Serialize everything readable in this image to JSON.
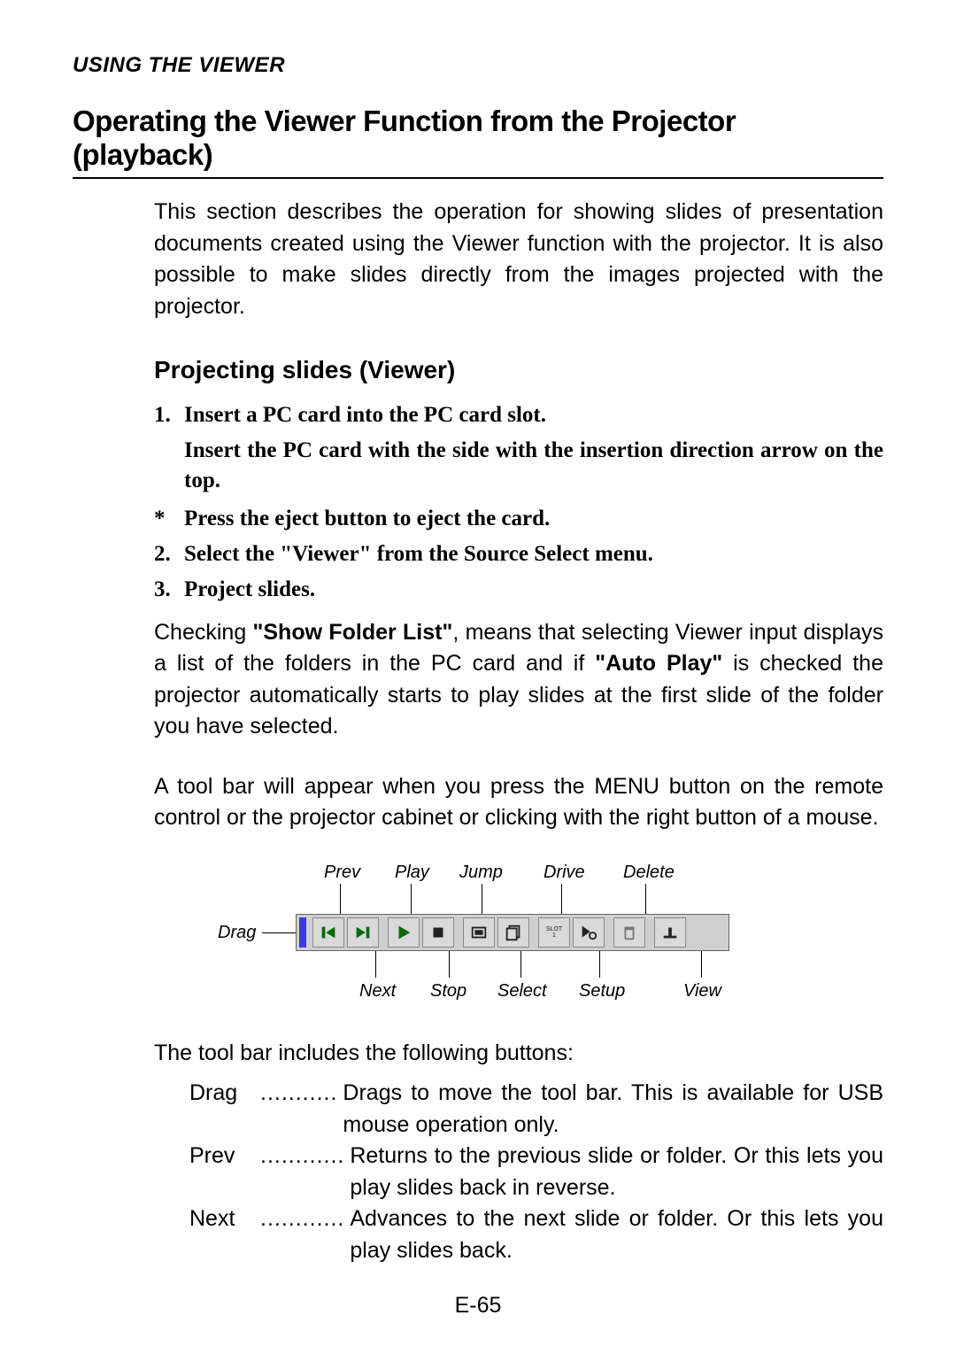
{
  "header": "USING THE VIEWER",
  "title": "Operating the Viewer Function from the Projector (playback)",
  "intro": "This section describes the operation for showing slides of presentation documents created using the Viewer function with the projector. It is also possible to make slides directly from the images projected with the projector.",
  "subhead": "Projecting slides (Viewer)",
  "steps": {
    "s1_num": "1.",
    "s1_txt": "Insert a PC card into the PC card slot.",
    "s1_sub": "Insert the PC card with the side with the insertion direction arrow on the top.",
    "star": "*",
    "star_txt": "Press the eject button to eject the card.",
    "s2_num": "2.",
    "s2_txt": "Select the \"Viewer\" from the Source Select menu.",
    "s3_num": "3.",
    "s3_txt": "Project slides."
  },
  "para1_pre": "Checking ",
  "para1_b1": "\"Show Folder List\"",
  "para1_mid": ", means that selecting Viewer input displays a list of the folders in the PC card and if ",
  "para1_b2": "\"Auto Play\"",
  "para1_post": " is checked the projector automatically starts to play slides at the first slide of the folder you have selected.",
  "para2": "A tool bar will appear when you press the MENU button on the remote control or the projector cabinet or clicking with the right button of a mouse.",
  "fig": {
    "drag": "Drag",
    "prev": "Prev",
    "play": "Play",
    "jump": "Jump",
    "drive": "Drive",
    "delete": "Delete",
    "next": "Next",
    "stop": "Stop",
    "select": "Select",
    "setup": "Setup",
    "view": "View",
    "slot": "SLOT\n1"
  },
  "para3": "The tool bar includes the following buttons:",
  "defs": {
    "drag_term": "Drag",
    "drag_dots": "...........",
    "drag_desc": "Drags to move the tool bar. This is available for USB mouse operation only.",
    "prev_term": "Prev",
    "prev_dots": "............",
    "prev_desc": "Returns to the previous slide or folder. Or this lets you play slides back in reverse.",
    "next_term": "Next",
    "next_dots": "............",
    "next_desc": "Advances to the next slide or folder. Or this lets you play slides back."
  },
  "pageno": "E-65"
}
